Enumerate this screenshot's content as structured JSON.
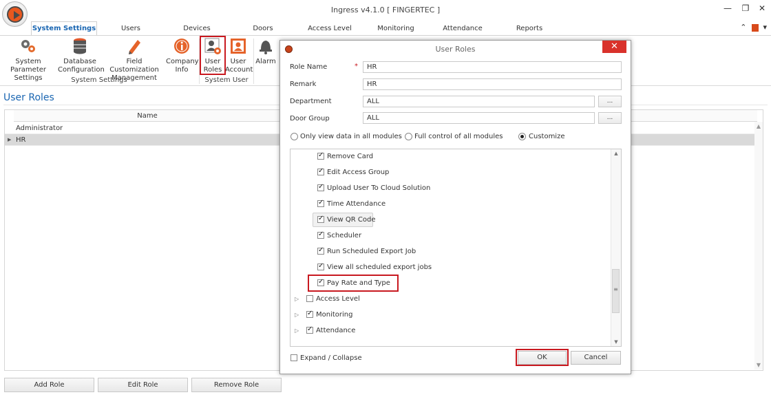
{
  "window": {
    "title": "Ingress v4.1.0 [ FINGERTEC ]"
  },
  "tabs": [
    {
      "label": "System Settings"
    },
    {
      "label": "Users"
    },
    {
      "label": "Devices"
    },
    {
      "label": "Doors"
    },
    {
      "label": "Access Level"
    },
    {
      "label": "Monitoring"
    },
    {
      "label": "Attendance"
    },
    {
      "label": "Reports"
    }
  ],
  "ribbon": {
    "items": [
      {
        "line1": "System Parameter",
        "line2": "Settings",
        "icon": "gears-icon"
      },
      {
        "line1": "Database",
        "line2": "Configuration",
        "icon": "database-icon"
      },
      {
        "line1": "Field Customization",
        "line2": "Management",
        "icon": "pencil-icon"
      },
      {
        "line1": "Company",
        "line2": "Info",
        "icon": "info-icon"
      },
      {
        "line1": "User",
        "line2": "Roles",
        "icon": "user-roles-icon"
      },
      {
        "line1": "User",
        "line2": "Account",
        "icon": "user-account-icon"
      },
      {
        "line1": "Alarm",
        "line2": "",
        "icon": "alarm-icon"
      }
    ],
    "groups": [
      "System Settings",
      "System User"
    ]
  },
  "panel": {
    "title": "User Roles",
    "column_name": "Name",
    "rows": [
      "Administrator",
      "HR"
    ],
    "buttons": {
      "add": "Add Role",
      "edit": "Edit Role",
      "remove": "Remove Role"
    }
  },
  "dialog": {
    "title": "User Roles",
    "fields": {
      "role_name_label": "Role Name",
      "role_name_value": "HR",
      "remark_label": "Remark",
      "remark_value": "HR",
      "department_label": "Department",
      "department_value": "ALL",
      "door_group_label": "Door Group",
      "door_group_value": "ALL",
      "browse": "..."
    },
    "modes": {
      "view_only": "Only view data in all modules",
      "full": "Full control of all modules",
      "customize": "Customize",
      "selected": "customize"
    },
    "tree": [
      "Remove Card",
      "Edit Access Group",
      "Upload User To Cloud Solution",
      "Time Attendance",
      "View QR Code",
      "Scheduler",
      "Run Scheduled Export Job",
      "View all scheduled export jobs",
      "Pay Rate and Type"
    ],
    "tree_parents": [
      {
        "label": "Access Level",
        "checked": false
      },
      {
        "label": "Monitoring",
        "checked": true
      },
      {
        "label": "Attendance",
        "checked": true
      }
    ],
    "expand_collapse": "Expand / Collapse",
    "ok": "OK",
    "cancel": "Cancel"
  },
  "colors": {
    "accent": "#1a66b2",
    "highlight": "#c8181f",
    "close": "#d9322b"
  }
}
